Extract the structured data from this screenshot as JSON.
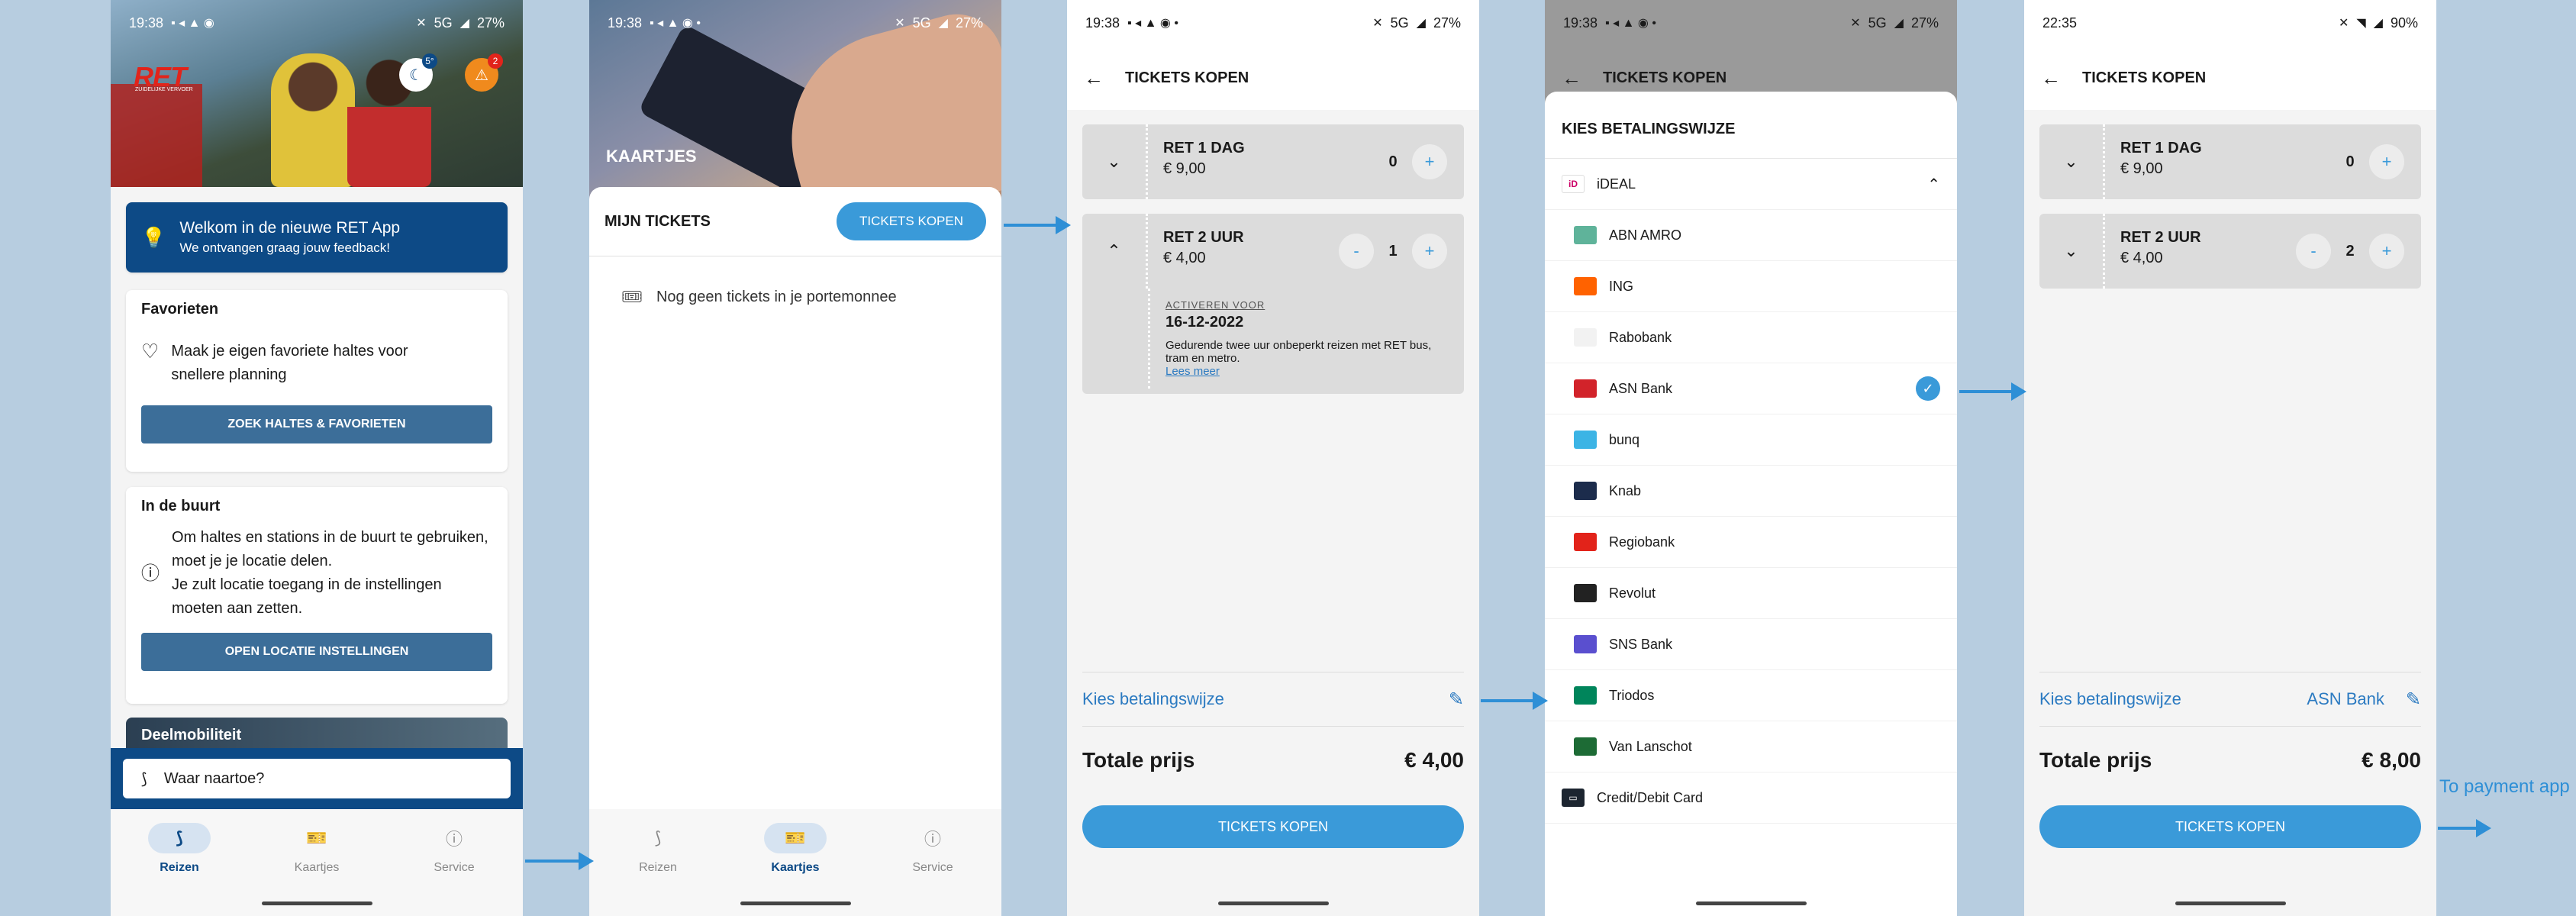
{
  "phone1": {
    "status": {
      "time": "19:38",
      "network": "5G",
      "battery": "27%"
    },
    "logo_text": "RET",
    "logo_sub": "ZUIDELIJKE VERVOER",
    "temp_badge": "5°",
    "alert_count": "2",
    "welcome": {
      "title": "Welkom in de nieuwe RET App",
      "subtitle": "We ontvangen graag jouw feedback!"
    },
    "favorieten": {
      "title": "Favorieten",
      "text": "Maak je eigen favoriete haltes voor snellere planning",
      "button": "ZOEK HALTES & FAVORIETEN"
    },
    "buurt": {
      "title": "In de buurt",
      "text1": "Om haltes en stations in de buurt te gebruiken, moet je je locatie delen.",
      "text2": "Je zult locatie toegang in de instellingen moeten aan zetten.",
      "button": "OPEN LOCATIE INSTELLINGEN"
    },
    "deel_title": "Deelmobiliteit",
    "search_placeholder": "Waar naartoe?",
    "nav": [
      "Reizen",
      "Kaartjes",
      "Service"
    ]
  },
  "phone2": {
    "status": {
      "time": "19:38",
      "network": "5G",
      "battery": "27%"
    },
    "hero_title": "KAARTJES",
    "section_title": "MIJN TICKETS",
    "buy_button": "TICKETS KOPEN",
    "empty_text": "Nog geen tickets in je portemonnee",
    "nav": [
      "Reizen",
      "Kaartjes",
      "Service"
    ]
  },
  "phone3": {
    "status": {
      "time": "19:38",
      "network": "5G",
      "battery": "27%"
    },
    "title": "TICKETS KOPEN",
    "tickets": [
      {
        "name": "RET 1 DAG",
        "price": "€ 9,00",
        "qty": "0"
      },
      {
        "name": "RET 2 UUR",
        "price": "€ 4,00",
        "qty": "1"
      }
    ],
    "activate_label": "ACTIVEREN VOOR",
    "activate_date": "16-12-2022",
    "desc": "Gedurende twee uur onbeperkt reizen met RET bus, tram en metro.",
    "more_link": "Lees meer",
    "pay_label": "Kies betalingswijze",
    "total_label": "Totale prijs",
    "total_value": "€ 4,00",
    "buy_button": "TICKETS KOPEN"
  },
  "phone4": {
    "status": {
      "time": "19:38",
      "network": "5G",
      "battery": "27%"
    },
    "title": "TICKETS KOPEN",
    "modal_title": "KIES BETALINGSWIJZE",
    "method": "iDEAL",
    "banks": [
      {
        "name": "ABN AMRO",
        "color": "#5fb39a"
      },
      {
        "name": "ING",
        "color": "#ff6200"
      },
      {
        "name": "Rabobank",
        "color": "#f2f2f2"
      },
      {
        "name": "ASN Bank",
        "color": "#d2232a"
      },
      {
        "name": "bunq",
        "color": "#3cb4e5"
      },
      {
        "name": "Knab",
        "color": "#1c2c4c"
      },
      {
        "name": "Regiobank",
        "color": "#e2231a"
      },
      {
        "name": "Revolut",
        "color": "#222222"
      },
      {
        "name": "SNS Bank",
        "color": "#5a4fcf"
      },
      {
        "name": "Triodos",
        "color": "#00855b"
      },
      {
        "name": "Van Lanschot",
        "color": "#1d6b35"
      }
    ],
    "card_option": "Credit/Debit Card"
  },
  "phone5": {
    "status": {
      "time": "22:35",
      "battery": "90%"
    },
    "title": "TICKETS KOPEN",
    "tickets": [
      {
        "name": "RET 1 DAG",
        "price": "€ 9,00",
        "qty": "0"
      },
      {
        "name": "RET 2 UUR",
        "price": "€ 4,00",
        "qty": "2"
      }
    ],
    "pay_label": "Kies betalingswijze",
    "pay_selected": "ASN Bank",
    "total_label": "Totale prijs",
    "total_value": "€ 8,00",
    "buy_button": "TICKETS KOPEN"
  },
  "annotation": "To payment app"
}
